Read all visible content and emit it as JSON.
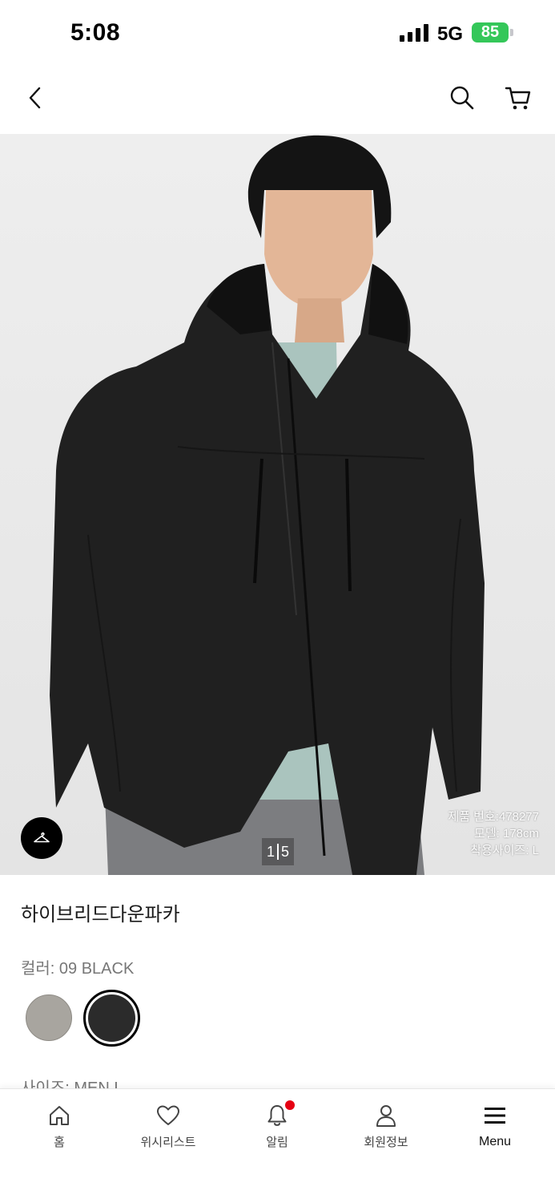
{
  "status_bar": {
    "time": "5:08",
    "network": "5G",
    "battery": "85"
  },
  "nav": {
    "back_icon": "chevron-left-icon",
    "search_icon": "search-icon",
    "cart_icon": "cart-icon"
  },
  "gallery": {
    "current_page": "1",
    "total_pages": "5",
    "product_number": "제품 번호:478277",
    "model_height": "모델: 178cm",
    "worn_size": "착용사이즈: L",
    "fitting_icon": "hanger-icon"
  },
  "product": {
    "name": "하이브리드다운파카",
    "color_label": "컬러: 09 BLACK",
    "size_label": "사이즈: MEN L",
    "swatches": [
      {
        "color": "#a8a59f",
        "selected": false
      },
      {
        "color": "#2b2b2b",
        "selected": true
      }
    ]
  },
  "tabbar": {
    "items": [
      {
        "label": "홈",
        "icon": "home-icon"
      },
      {
        "label": "위시리스트",
        "icon": "heart-icon"
      },
      {
        "label": "알림",
        "icon": "bell-icon"
      },
      {
        "label": "회원정보",
        "icon": "user-icon"
      },
      {
        "label": "Menu",
        "icon": "menu-icon"
      }
    ],
    "accent": "#e60012"
  }
}
